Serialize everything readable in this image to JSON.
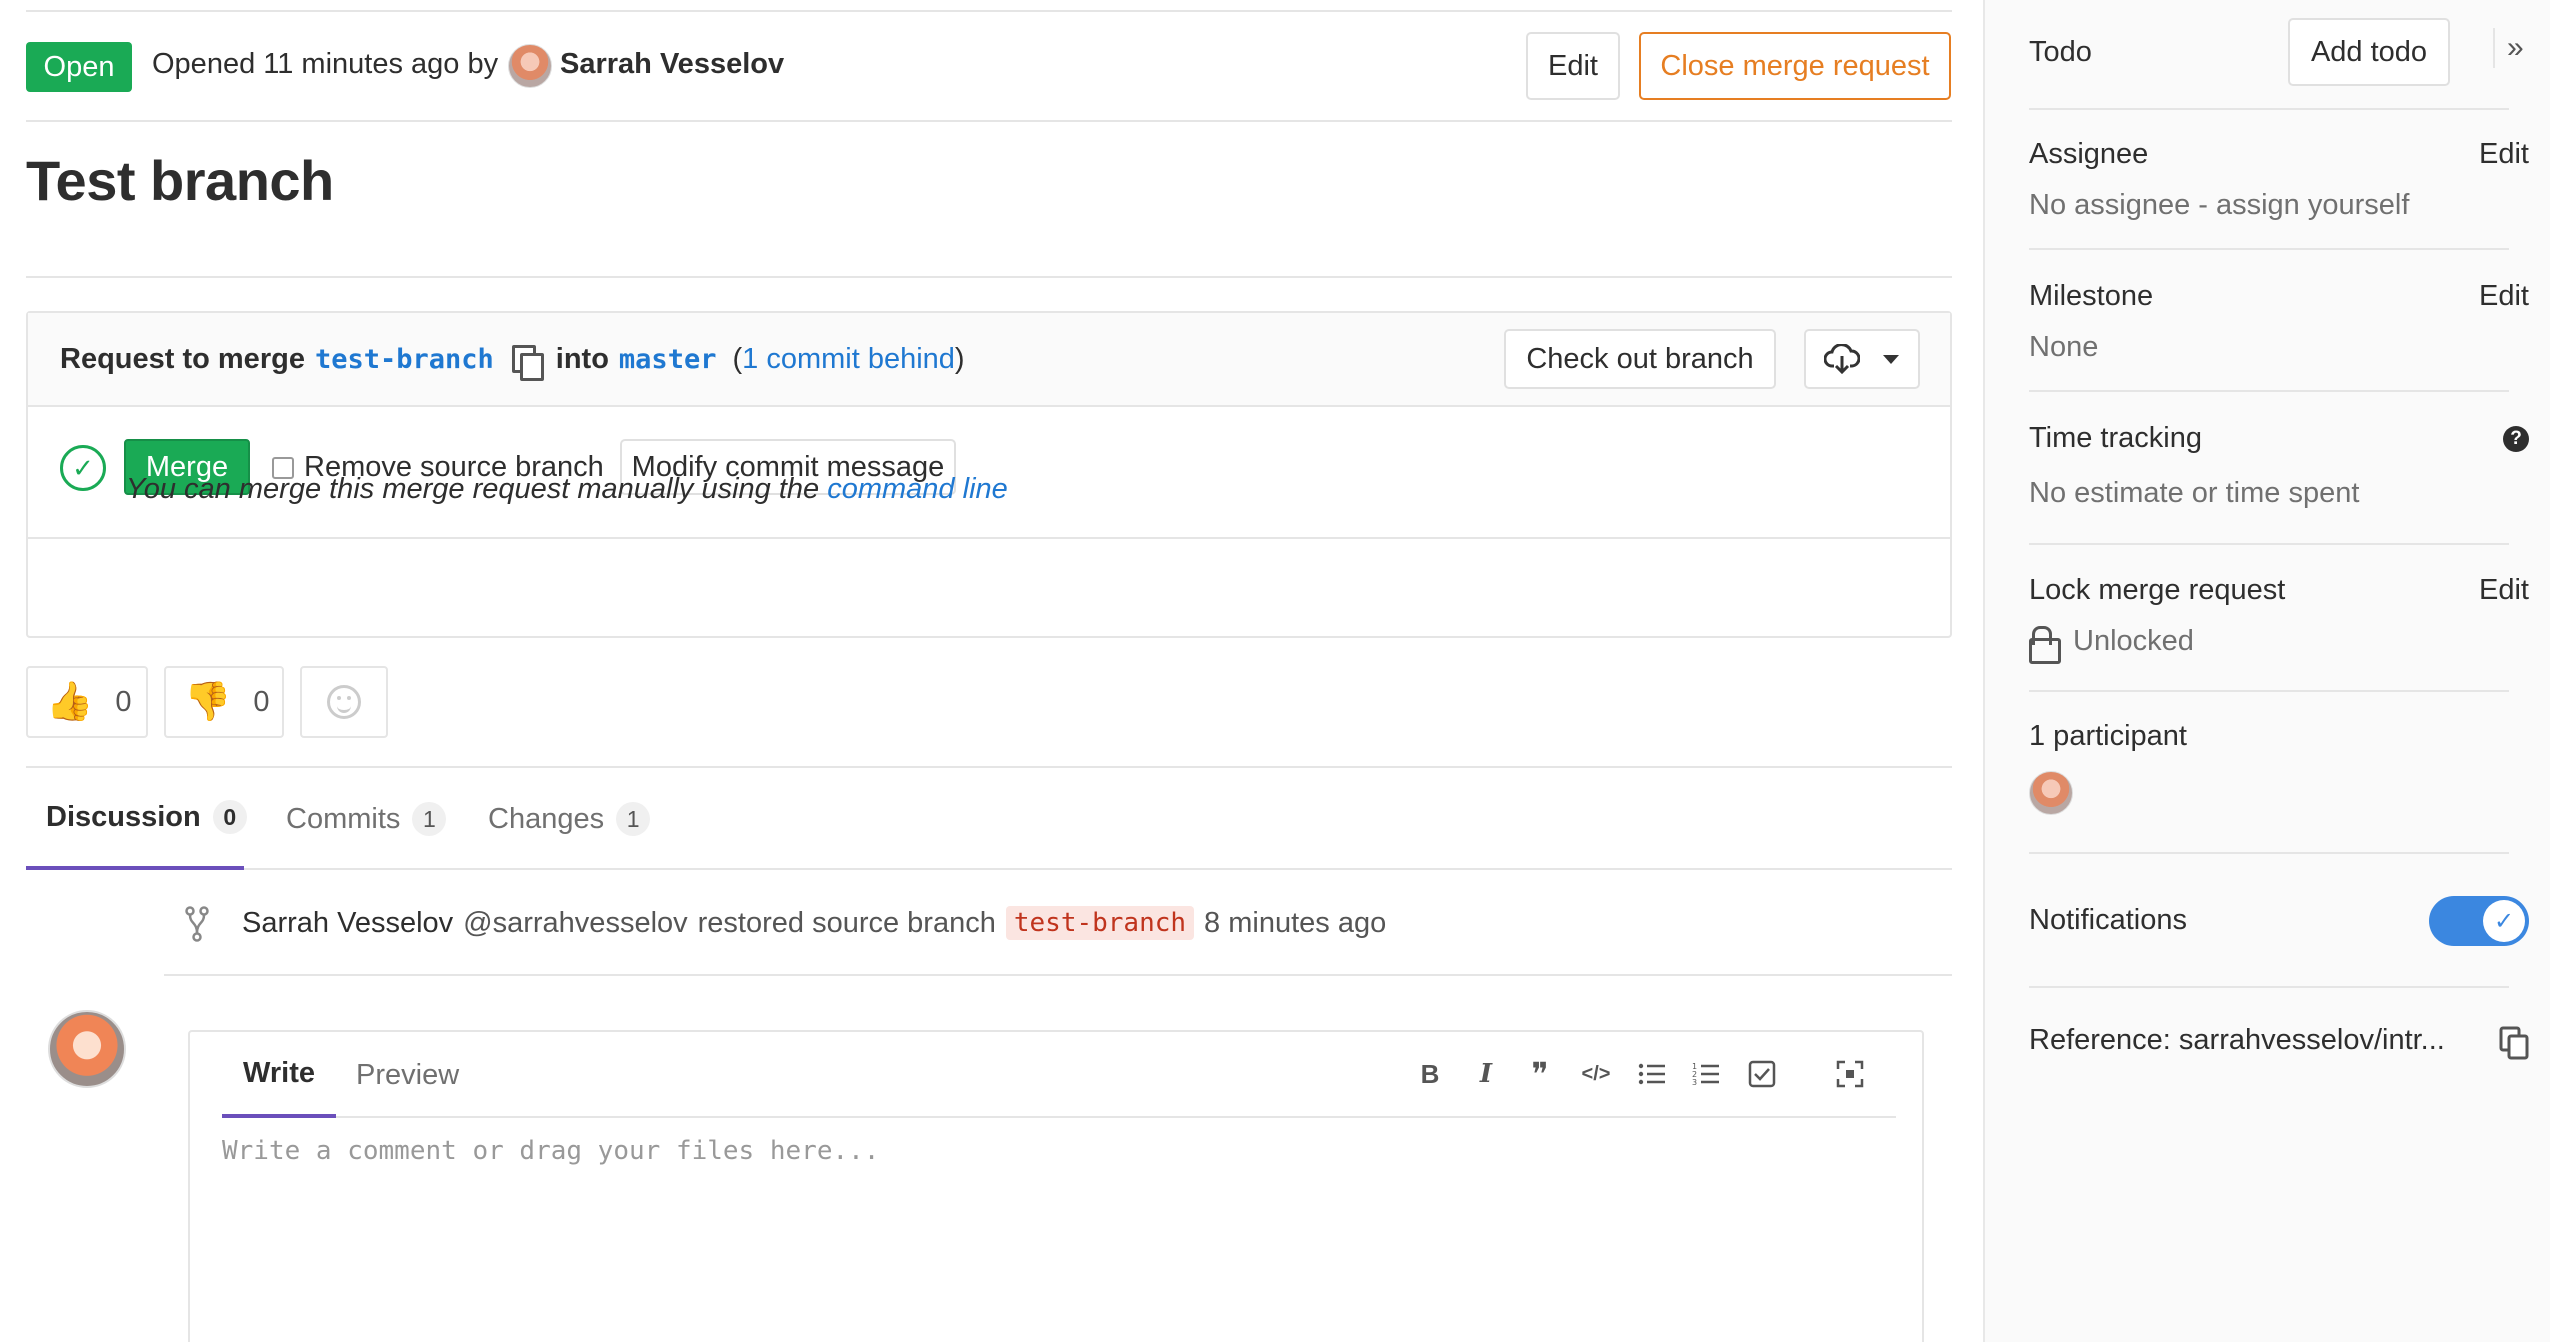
{
  "header": {
    "status": "Open",
    "opened_text": "Opened 11 minutes ago by",
    "author_name": "Sarrah Vesselov",
    "edit_label": "Edit",
    "close_label": "Close merge request"
  },
  "title": "Test branch",
  "merge_widget": {
    "request_prefix": "Request to merge",
    "source_branch": "test-branch",
    "into_label": "into",
    "target_branch": "master",
    "behind_open": "(",
    "behind_link": "1 commit behind",
    "behind_close": ")",
    "checkout_label": "Check out branch",
    "merge_label": "Merge",
    "remove_source_label": "Remove source branch",
    "modify_commit_label": "Modify commit message",
    "manual_prefix": "You can merge this merge request manually using the",
    "manual_link": "command line"
  },
  "awards": {
    "thumbs_up_count": "0",
    "thumbs_down_count": "0"
  },
  "tabs": [
    {
      "label": "Discussion",
      "count": "0"
    },
    {
      "label": "Commits",
      "count": "1"
    },
    {
      "label": "Changes",
      "count": "1"
    }
  ],
  "system_note": {
    "author": "Sarrah Vesselov",
    "handle": "@sarrahvesselov",
    "action": "restored source branch",
    "branch": "test-branch",
    "time": "8 minutes ago"
  },
  "comment_form": {
    "write_tab": "Write",
    "preview_tab": "Preview",
    "placeholder": "Write a comment or drag your files here...",
    "toolbar": {
      "bold": "B",
      "italic": "I",
      "quote": "❞",
      "code": "</>"
    }
  },
  "sidebar": {
    "todo_label": "Todo",
    "add_todo_label": "Add todo",
    "collapse": "»",
    "assignee": {
      "label": "Assignee",
      "edit": "Edit",
      "value": "No assignee - assign yourself"
    },
    "milestone": {
      "label": "Milestone",
      "edit": "Edit",
      "value": "None"
    },
    "time_tracking": {
      "label": "Time tracking",
      "help": "?",
      "value": "No estimate or time spent"
    },
    "lock": {
      "label": "Lock merge request",
      "edit": "Edit",
      "value": "Unlocked"
    },
    "participants": {
      "label": "1 participant"
    },
    "notifications": {
      "label": "Notifications",
      "enabled": true,
      "check": "✓"
    },
    "reference": {
      "label": "Reference: sarrahvesselov/intr..."
    }
  },
  "colors": {
    "success": "#1aaa55",
    "link": "#1f78d1",
    "warning": "#e67e22",
    "active_tab": "#6b4fbb",
    "toggle": "#3b87e0"
  }
}
